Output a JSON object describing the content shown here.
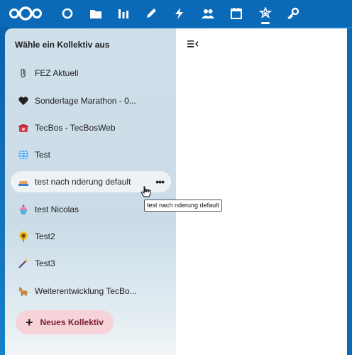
{
  "nav": {
    "icons": [
      "dashboard-icon",
      "files-icon",
      "activity-chart-icon",
      "notes-icon",
      "flash-icon",
      "contacts-icon",
      "calendar-icon",
      "collectives-icon",
      "passwords-key-icon"
    ],
    "active": "collectives-icon"
  },
  "sidebar": {
    "title": "Wähle ein Kollektiv aus",
    "items": [
      {
        "label": "FEZ Aktuell",
        "icon": "paperclip-icon"
      },
      {
        "label": "Sonderlage Marathon - 0...",
        "icon": "black-heart-icon"
      },
      {
        "label": "TecBos - TecBosWeb",
        "icon": "telephone-icon"
      },
      {
        "label": "Test",
        "icon": "globe-icon"
      },
      {
        "label": "test nach nderung default",
        "icon": "ship-icon",
        "more": "•••"
      },
      {
        "label": "test Nicolas",
        "icon": "cupcake-icon"
      },
      {
        "label": "Test2",
        "icon": "sunflower-icon"
      },
      {
        "label": "Test3",
        "icon": "magic-wand-icon"
      },
      {
        "label": "Weiterentwicklung TecBo...",
        "icon": "dog-icon"
      }
    ],
    "new_button": {
      "label": "Neues Kollektiv",
      "plus": "+"
    }
  },
  "tooltip": "test nach nderung default",
  "colors": {
    "topbar": "#0b6ab8",
    "sidebar": "#cfe0ea",
    "new_button_bg": "#f6d3d8",
    "new_button_text": "#7a1e2e"
  }
}
